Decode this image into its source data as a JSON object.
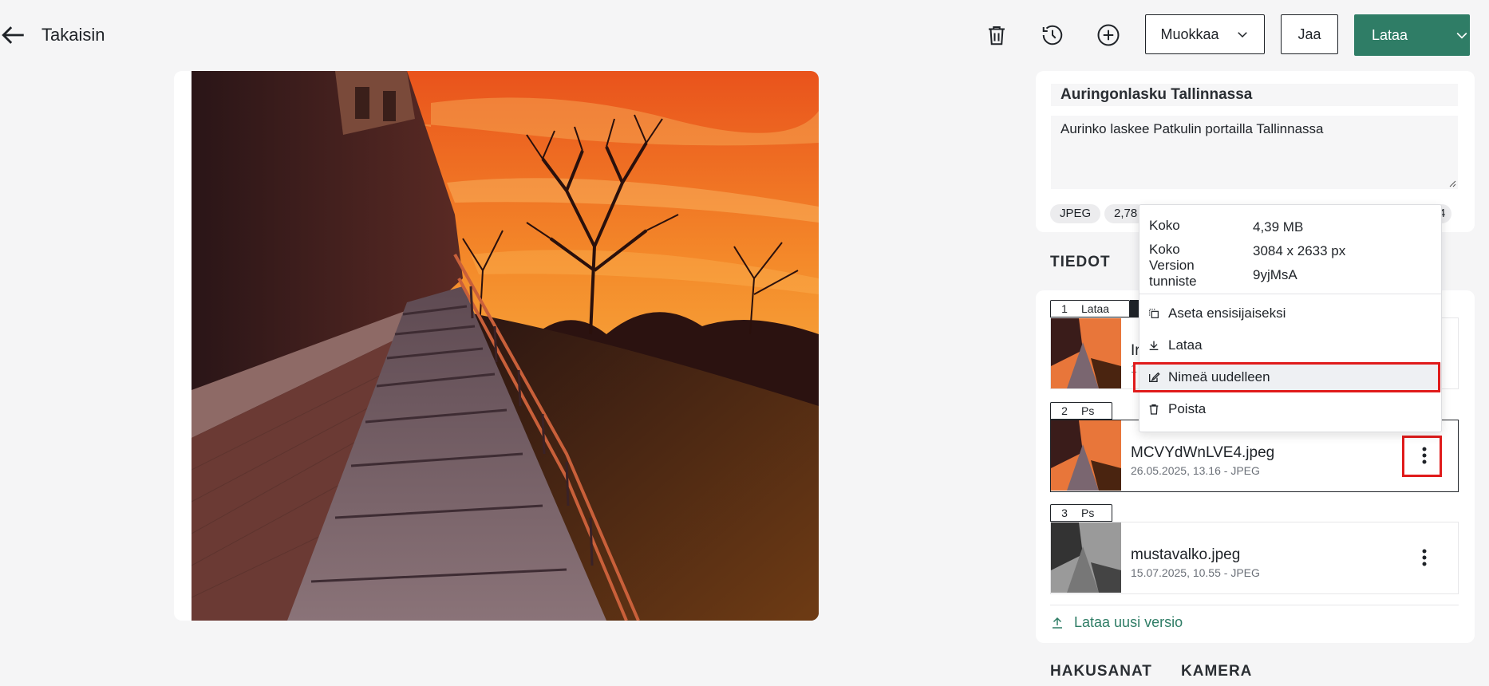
{
  "topbar": {
    "back_label": "Takaisin",
    "edit_label": "Muokkaa",
    "share_label": "Jaa",
    "download_label": "Lataa"
  },
  "asset": {
    "title": "Auringonlasku Tallinnassa",
    "description": "Aurinko laskee Patkulin portailla Tallinnassa",
    "chips": [
      "JPEG",
      "2,78",
      "4"
    ]
  },
  "sections": {
    "details": "TIEDOT",
    "keywords": "HAKUSANAT",
    "camera": "KAMERA"
  },
  "versions": [
    {
      "num": "1",
      "tag": "Lataa",
      "name": "Ir",
      "meta": "1"
    },
    {
      "num": "2",
      "tag": "Ps",
      "name": "MCVYdWnLVE4.jpeg",
      "meta": "26.05.2025, 13.16 - JPEG"
    },
    {
      "num": "3",
      "tag": "Ps",
      "name": "mustavalko.jpeg",
      "meta": "15.07.2025, 10.55 - JPEG"
    }
  ],
  "upload_new_version": "Lataa uusi versio",
  "context_menu": {
    "info": [
      {
        "label": "Koko",
        "value": "4,39 MB"
      },
      {
        "label": "Koko",
        "value": "3084 x 2633 px"
      },
      {
        "label": "Version\ntunniste",
        "value": "9yjMsA"
      }
    ],
    "items": {
      "set_primary": "Aseta ensisijaiseksi",
      "download": "Lataa",
      "rename": "Nimeä uudelleen",
      "delete": "Poista"
    }
  },
  "colors": {
    "accent": "#2f7d66",
    "highlight": "#e01b1b"
  }
}
